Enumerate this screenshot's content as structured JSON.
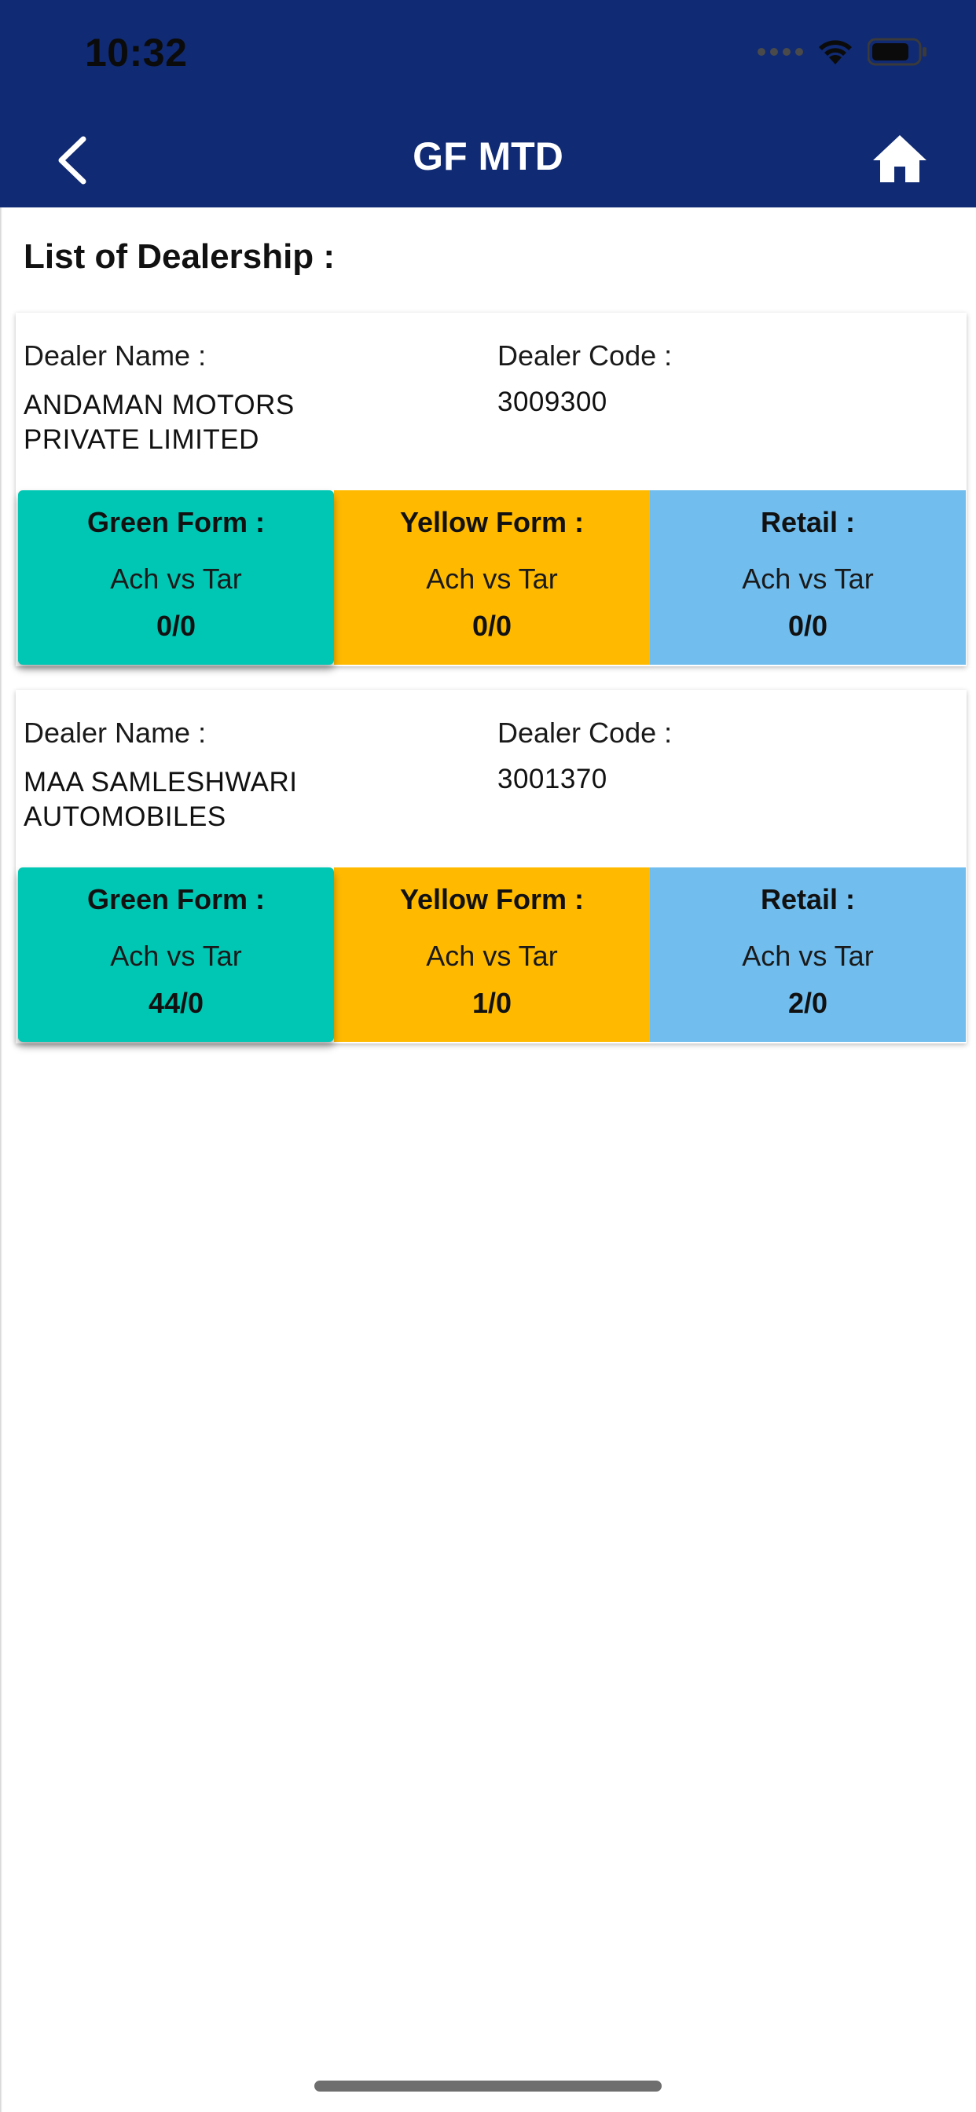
{
  "status_bar": {
    "time": "10:32"
  },
  "header": {
    "title": "GF MTD",
    "back_icon": "chevron-left-icon",
    "home_icon": "home-icon"
  },
  "section_title": "List of Dealership :",
  "labels": {
    "dealer_name": "Dealer Name :",
    "dealer_code": "Dealer Code :",
    "green_form": "Green Form :",
    "yellow_form": "Yellow Form :",
    "retail": "Retail :",
    "ach_vs_tar": "Ach vs Tar"
  },
  "colors": {
    "header_bg": "#102a73",
    "green_form": "#00c7b4",
    "yellow_form": "#ffba00",
    "retail": "#70bdee"
  },
  "dealers": [
    {
      "name_line1": "ANDAMAN MOTORS",
      "name_line2": "PRIVATE LIMITED",
      "code": "3009300",
      "green_form": "0/0",
      "yellow_form": "0/0",
      "retail": "0/0"
    },
    {
      "name_line1": "MAA SAMLESHWARI",
      "name_line2": "AUTOMOBILES",
      "code": "3001370",
      "green_form": "44/0",
      "yellow_form": "1/0",
      "retail": "2/0"
    }
  ]
}
